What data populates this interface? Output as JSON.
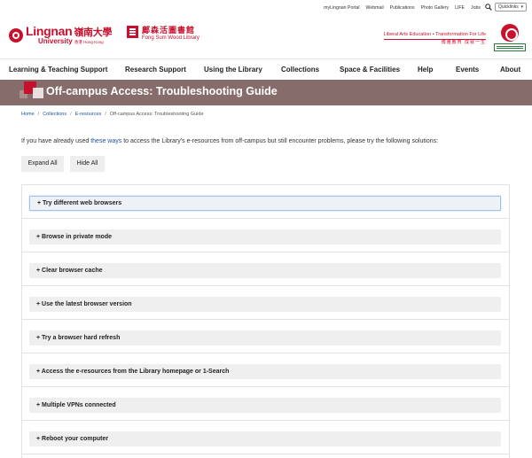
{
  "utility": {
    "links": [
      "myLingnan Portal",
      "Webmail",
      "Publications",
      "Photo Gallery",
      "LIFE",
      "Jobs"
    ],
    "quicklinks_label": "Quicklinks"
  },
  "header": {
    "lingnan_logo_en": "Lingnan",
    "lingnan_logo_cjk": "嶺南大學",
    "lingnan_logo_university": "University",
    "lingnan_logo_hk": "香港 Hong Kong",
    "library_logo_cjk": "鄺森活圖書館",
    "library_logo_en": "Fong Sum Wood Library",
    "motto_en": "Liberal Arts Education • Transformation For Life",
    "motto_cjk": "博雅教育 成就一生"
  },
  "nav": {
    "items": [
      "Learning & Teaching Support",
      "Research Support",
      "Using the Library",
      "Collections",
      "Space & Facilities",
      "Help",
      "Events",
      "About"
    ]
  },
  "banner": {
    "title": "Off-campus Access: Troubleshooting Guide"
  },
  "breadcrumb": {
    "home": "Home",
    "collections": "Collections",
    "eresources": "E-resources",
    "current": "Off-campus Access: Troubleshooting Guide"
  },
  "intro": {
    "before": "If you have already used ",
    "link": "these ways",
    "after": " to access the Library's e-resources from off-campus but still encounter problems, please try the following solutions:"
  },
  "buttons": {
    "expand_all": "Expand All",
    "hide_all": "Hide All"
  },
  "accordion": {
    "items": [
      "+ Try different web browsers",
      "+ Browse in private mode",
      "+ Clear browser cache",
      "+ Use the latest browser version",
      "+ Try a browser hard refresh",
      "+ Access the e-resources from the Library homepage or 1-Search",
      "+ Multiple VPNs connected",
      "+ Reboot your computer"
    ]
  },
  "colors": {
    "brand_red": "#c8102e",
    "banner_bg": "#866d6c",
    "link_blue": "#1a4f9c"
  }
}
